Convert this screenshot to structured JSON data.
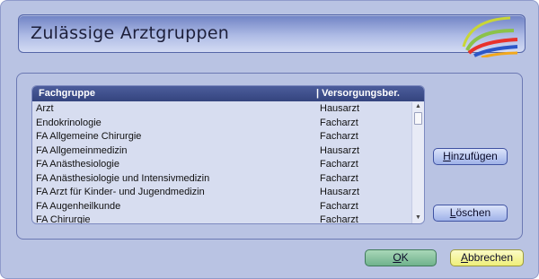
{
  "dialog": {
    "title": "Zulässige Arztgruppen"
  },
  "list": {
    "headers": {
      "col1": "Fachgruppe",
      "col2": "| Versorgungsber."
    },
    "rows": [
      {
        "fachgruppe": "Arzt",
        "versorgung": "Hausarzt"
      },
      {
        "fachgruppe": "Endokrinologie",
        "versorgung": "Facharzt"
      },
      {
        "fachgruppe": "FA Allgemeine Chirurgie",
        "versorgung": "Facharzt"
      },
      {
        "fachgruppe": "FA Allgemeinmedizin",
        "versorgung": "Hausarzt"
      },
      {
        "fachgruppe": "FA Anästhesiologie",
        "versorgung": "Facharzt"
      },
      {
        "fachgruppe": "FA Anästhesiologie und Intensivmedizin",
        "versorgung": "Facharzt"
      },
      {
        "fachgruppe": "FA Arzt für Kinder- und Jugendmedizin",
        "versorgung": "Hausarzt"
      },
      {
        "fachgruppe": "FA Augenheilkunde",
        "versorgung": "Facharzt"
      },
      {
        "fachgruppe": "FA Chirurgie",
        "versorgung": "Facharzt"
      }
    ]
  },
  "buttons": {
    "add": {
      "mnemonic": "H",
      "rest": "inzufügen"
    },
    "delete": {
      "mnemonic": "L",
      "rest": "öschen"
    },
    "ok": {
      "mnemonic": "O",
      "rest": "K"
    },
    "cancel": {
      "mnemonic": "A",
      "rest": "bbrechen"
    }
  }
}
